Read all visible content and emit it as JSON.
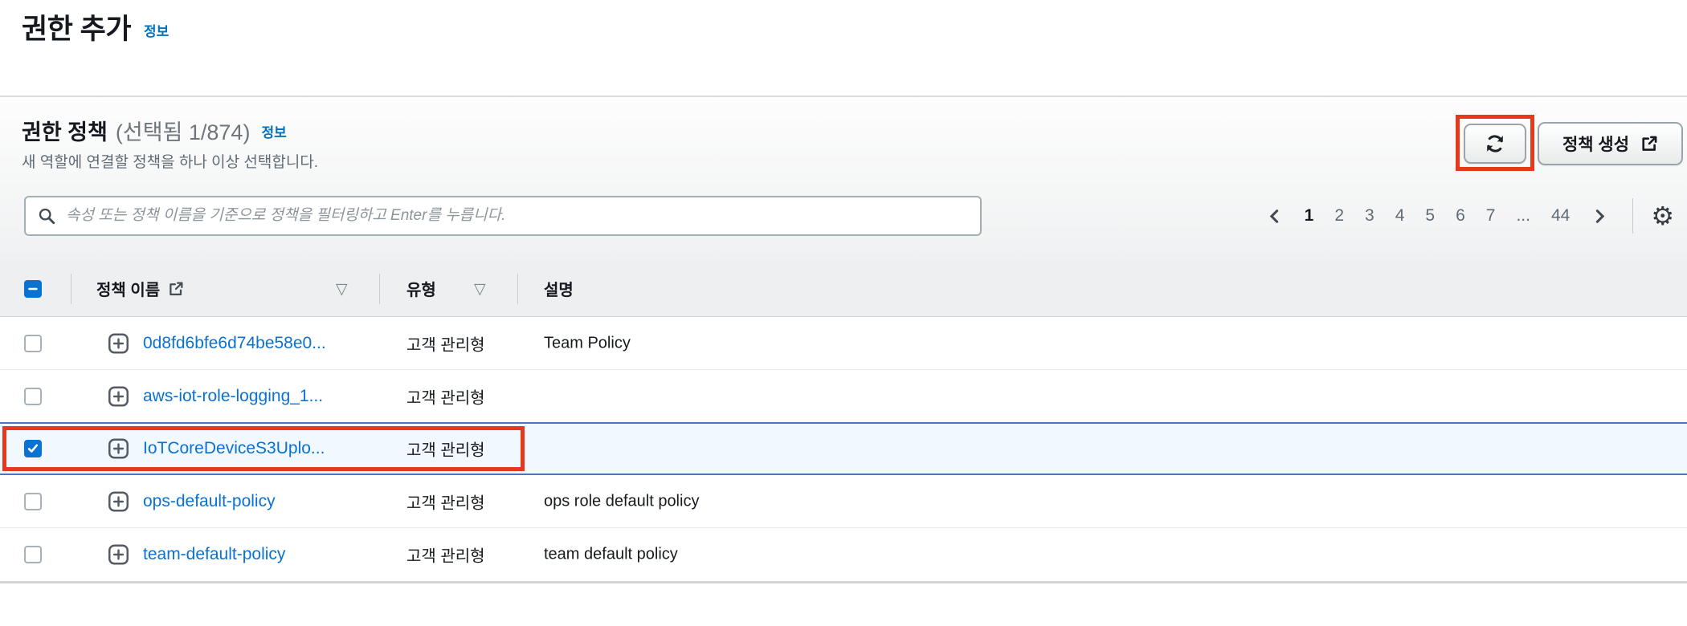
{
  "page": {
    "title": "권한 추가",
    "info_label": "정보"
  },
  "panel": {
    "title": "권한 정책",
    "selection_summary": "(선택됨 1/874)",
    "info_label": "정보",
    "subtitle": "새 역할에 연결할 정책을 하나 이상 선택합니다.",
    "create_policy_label": "정책 생성"
  },
  "search": {
    "placeholder": "속성 또는 정책 이름을 기준으로 정책을 필터링하고 Enter를 누릅니다.",
    "value": ""
  },
  "pagination": {
    "current_page": "1",
    "pages": [
      "1",
      "2",
      "3",
      "4",
      "5",
      "6",
      "7",
      "...",
      "44"
    ]
  },
  "table": {
    "select_all_state": "indeterminate",
    "columns": {
      "name": "정책 이름",
      "type": "유형",
      "description": "설명"
    },
    "rows": [
      {
        "name": "0d8fd6bfe6d74be58e0...",
        "type": "고객 관리형",
        "description": "Team Policy",
        "checked": false,
        "selected": false
      },
      {
        "name": "aws-iot-role-logging_1...",
        "type": "고객 관리형",
        "description": "",
        "checked": false,
        "selected": false
      },
      {
        "name": "IoTCoreDeviceS3Uplo...",
        "type": "고객 관리형",
        "description": "",
        "checked": true,
        "selected": true
      },
      {
        "name": "ops-default-policy",
        "type": "고객 관리형",
        "description": "ops role default policy",
        "checked": false,
        "selected": false
      },
      {
        "name": "team-default-policy",
        "type": "고객 관리형",
        "description": "team default policy",
        "checked": false,
        "selected": false
      }
    ]
  },
  "icons": {
    "search": "magnifier",
    "refresh": "circular-arrows",
    "external_link": "arrow-out-of-box",
    "settings": "gear",
    "sort_caret": "triangle-down",
    "expand_row": "plus-square",
    "prev": "chevron-left",
    "next": "chevron-right",
    "sort_caret_glyph": "▽",
    "settings_glyph": "⚙"
  },
  "annotations": {
    "color": "#e6391c",
    "targets": [
      "refresh-button",
      "selected-policy-row"
    ]
  },
  "colors": {
    "link_blue": "#0972d3",
    "checkbox_blue": "#0972d3",
    "annotation_red": "#e6391c",
    "selected_row_bg": "#f1f8fe",
    "selected_row_border": "#4579bd"
  }
}
